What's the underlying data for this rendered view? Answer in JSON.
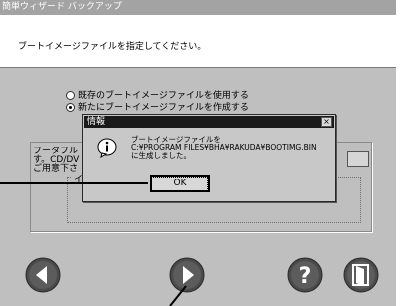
{
  "wizard": {
    "title": "簡単ウィザード バックアップ",
    "instruction": "ブートイメージファイルを指定してください。",
    "radio_options": [
      {
        "label": "既存のブートイメージファイルを使用する",
        "checked": false
      },
      {
        "label": "新たにブートイメージファイルを作成する",
        "checked": true
      }
    ],
    "bootable_text": [
      "ブータブル",
      "す。CD/DV",
      "ご用意下さ"
    ],
    "inner_caption": "イ"
  },
  "dialog": {
    "title": "情報",
    "close_label": "×",
    "message": [
      "ブートイメージファイルを",
      "C:¥PROGRAM FILES¥BHA¥RAKUDA¥BOOTIMG.BIN",
      "に生成しました。"
    ],
    "ok_label": "OK",
    "icon": "info-icon"
  },
  "nav": {
    "back_icon": "back-arrow-icon",
    "next_icon": "next-arrow-icon",
    "help_icon": "help-icon",
    "exit_icon": "exit-icon"
  },
  "colors": {
    "window_bg": "#bfbfbf",
    "dialog_titlebar": "#1a1a1a",
    "button_dark": "#3a3a3a"
  }
}
